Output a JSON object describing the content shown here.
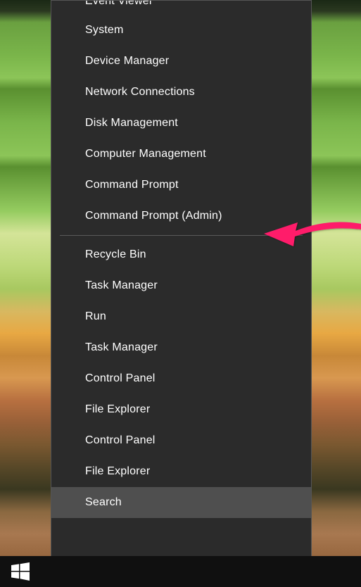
{
  "context_menu": {
    "group1": [
      {
        "label": "Event Viewer",
        "partial": true
      },
      {
        "label": "System"
      },
      {
        "label": "Device Manager"
      },
      {
        "label": "Network Connections"
      },
      {
        "label": "Disk Management"
      },
      {
        "label": "Computer Management"
      },
      {
        "label": "Command Prompt"
      },
      {
        "label": "Command Prompt (Admin)"
      }
    ],
    "group2": [
      {
        "label": "Recycle Bin"
      },
      {
        "label": "Task Manager"
      },
      {
        "label": "Run"
      },
      {
        "label": "Task Manager"
      },
      {
        "label": "Control Panel"
      },
      {
        "label": "File Explorer"
      },
      {
        "label": "Control Panel"
      },
      {
        "label": "File Explorer"
      },
      {
        "label": "Search",
        "highlighted": true
      }
    ]
  },
  "annotation": {
    "target": "Command Prompt (Admin)",
    "color": "#ff1a6b"
  }
}
